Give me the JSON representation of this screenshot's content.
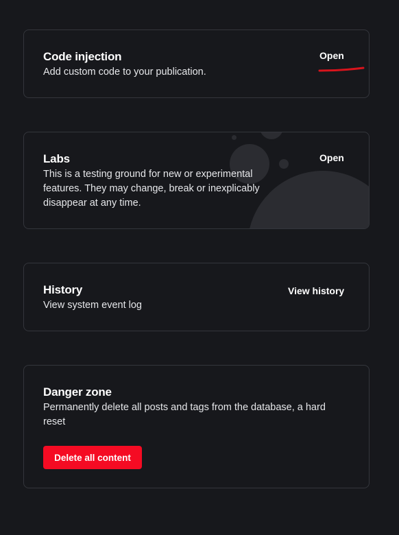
{
  "code_injection": {
    "title": "Code injection",
    "description": "Add custom code to your publication.",
    "action_label": "Open"
  },
  "labs": {
    "title": "Labs",
    "description": "This is a testing ground for new or experimental features. They may change, break or inexplicably disappear at any time.",
    "action_label": "Open"
  },
  "history": {
    "title": "History",
    "description": "View system event log",
    "action_label": "View history"
  },
  "danger_zone": {
    "title": "Danger zone",
    "description": "Permanently delete all posts and tags from the database, a hard reset",
    "button_label": "Delete all content"
  },
  "colors": {
    "background": "#17181c",
    "card_border": "#34363c",
    "danger": "#f50b23",
    "annotation": "#d8141c"
  }
}
